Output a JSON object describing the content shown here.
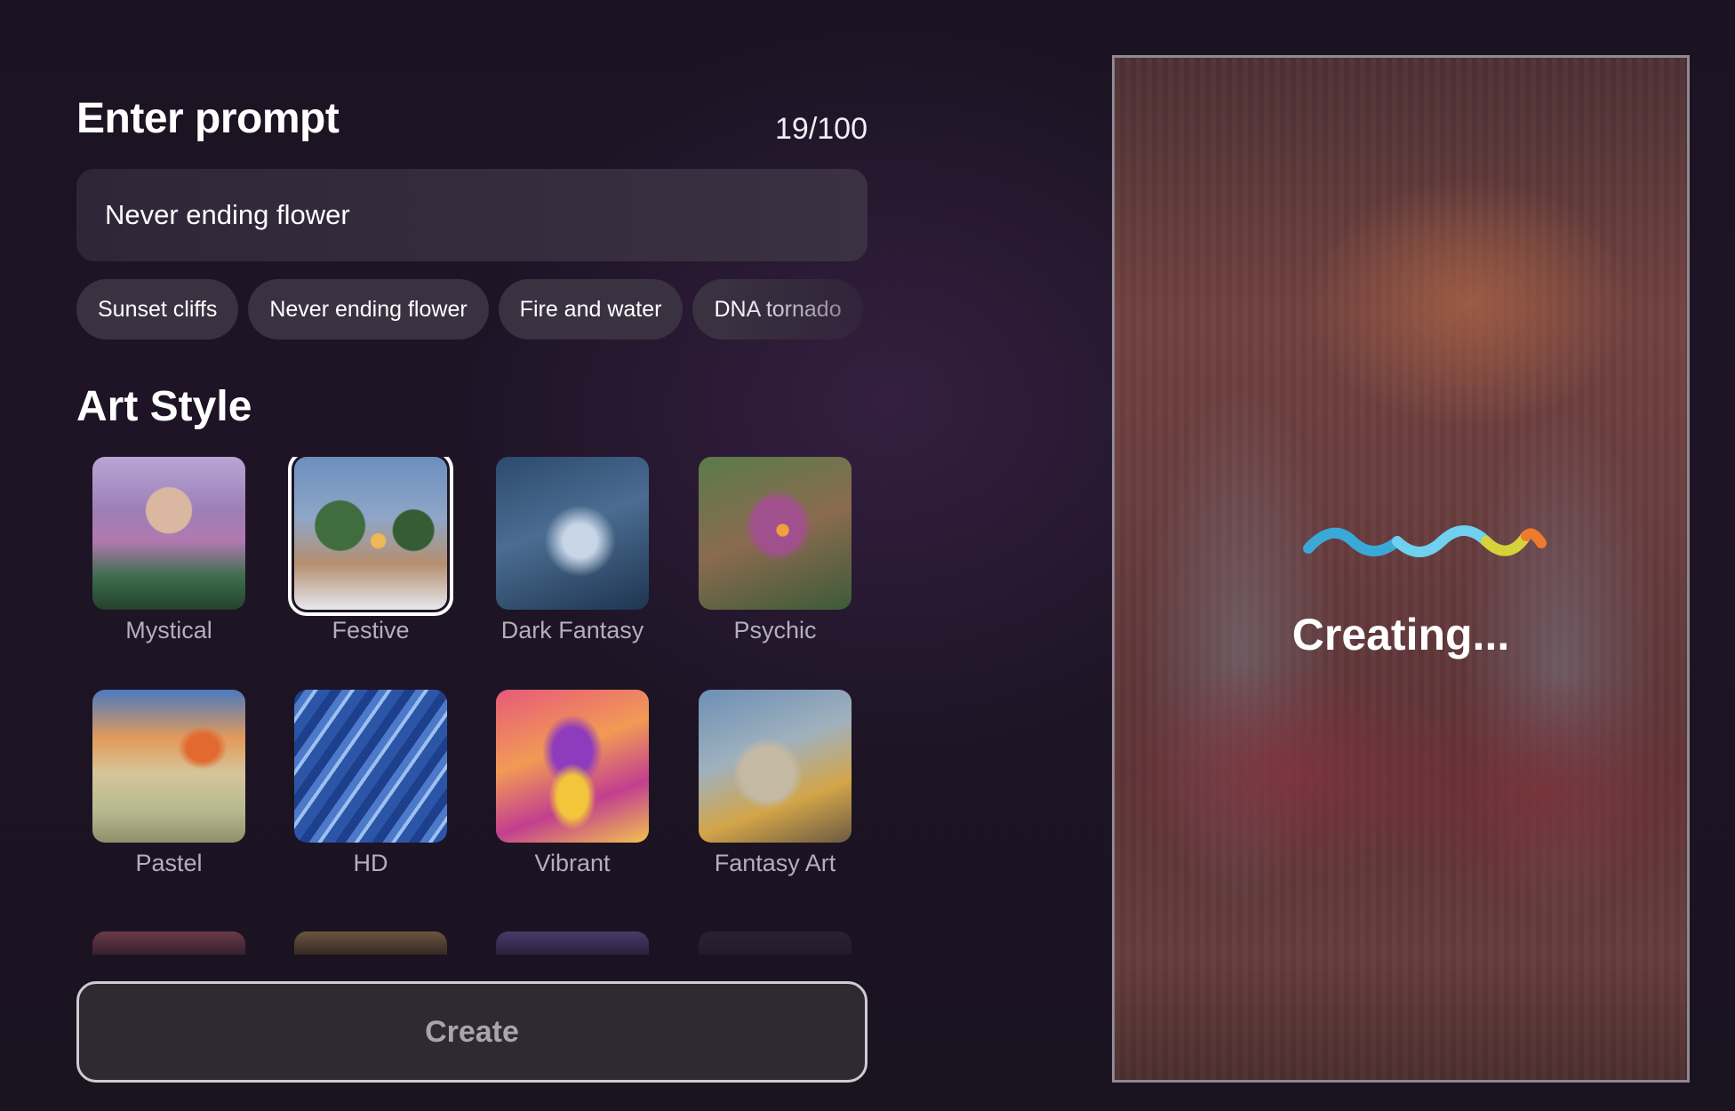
{
  "prompt": {
    "title": "Enter prompt",
    "char_count": "19/100",
    "value": "Never ending flower"
  },
  "suggestions": [
    "Sunset cliffs",
    "Never ending flower",
    "Fire and water",
    "DNA tornado"
  ],
  "art_style": {
    "title": "Art Style",
    "styles": [
      {
        "label": "Mystical",
        "selected": false
      },
      {
        "label": "Festive",
        "selected": true
      },
      {
        "label": "Dark Fantasy",
        "selected": false
      },
      {
        "label": "Psychic",
        "selected": false
      },
      {
        "label": "Pastel",
        "selected": false
      },
      {
        "label": "HD",
        "selected": false
      },
      {
        "label": "Vibrant",
        "selected": false
      },
      {
        "label": "Fantasy Art",
        "selected": false
      }
    ]
  },
  "create_button": {
    "label": "Create"
  },
  "preview": {
    "status": "Creating...",
    "loader_colors": [
      "#3ba9d8",
      "#6fd0f0",
      "#d6d23a",
      "#ee7a2e"
    ]
  }
}
